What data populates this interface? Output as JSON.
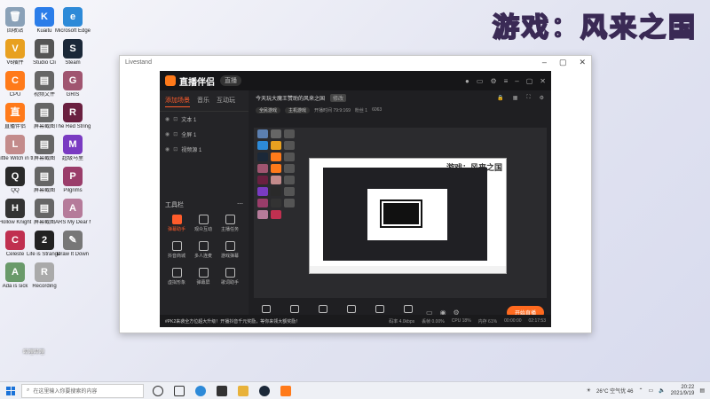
{
  "watermark": "游戏：风来之国",
  "desktop_icons": [
    {
      "label": "回收站",
      "color": "#8aa1b8",
      "glyph": "🗑"
    },
    {
      "label": "Kuaitu",
      "color": "#2b7de9",
      "glyph": "K"
    },
    {
      "label": "Microsoft Edge",
      "color": "#2d8ad8",
      "glyph": "e"
    },
    {
      "label": "V6插件",
      "color": "#e8a020",
      "glyph": "V"
    },
    {
      "label": "Studio Cli",
      "color": "#555",
      "glyph": "▤"
    },
    {
      "label": "Steam",
      "color": "#1b2838",
      "glyph": "S"
    },
    {
      "label": "CPU",
      "color": "#ff7a1a",
      "glyph": "C"
    },
    {
      "label": "视频文件",
      "color": "#666",
      "glyph": "▤"
    },
    {
      "label": "GRIS",
      "color": "#a05570",
      "glyph": "G"
    },
    {
      "label": "直播伴侣",
      "color": "#ff7a1a",
      "glyph": "直"
    },
    {
      "label": "屏幕截图",
      "color": "#666",
      "glyph": "▤"
    },
    {
      "label": "The Red Strings Club",
      "color": "#6a2040",
      "glyph": "R"
    },
    {
      "label": "Little Witch in the Woods",
      "color": "#c38b8b",
      "glyph": "L"
    },
    {
      "label": "屏幕截图",
      "color": "#666",
      "glyph": "▤"
    },
    {
      "label": "超级马里",
      "color": "#7a3bc2",
      "glyph": "M"
    },
    {
      "label": "QQ",
      "color": "#2a2a2a",
      "glyph": "Q"
    },
    {
      "label": "屏幕截图",
      "color": "#666",
      "glyph": "▤"
    },
    {
      "label": "Pilgrims",
      "color": "#9a3d6a",
      "glyph": "P"
    },
    {
      "label": "Hollow Knight",
      "color": "#333",
      "glyph": "H"
    },
    {
      "label": "屏幕截图",
      "color": "#666",
      "glyph": "▤"
    },
    {
      "label": "ARS My Dear M...",
      "color": "#b57b9a",
      "glyph": "A"
    },
    {
      "label": "Celeste",
      "color": "#c03050",
      "glyph": "C"
    },
    {
      "label": "Life is Strange 2",
      "color": "#222",
      "glyph": "2"
    },
    {
      "label": "Draw It Down",
      "color": "#777",
      "glyph": "✎"
    },
    {
      "label": "Ada is sick",
      "color": "#6a9a6a",
      "glyph": "A"
    },
    {
      "label": "Recording",
      "color": "#aaa",
      "glyph": "R"
    }
  ],
  "outer_window": {
    "title": "Livestand"
  },
  "app": {
    "name": "直播伴侣",
    "version_pill": "直播",
    "tabs": [
      "添加场景",
      "音乐",
      "互动玩"
    ],
    "active_tab": "添加场景",
    "sources": [
      "文本 1",
      "全屏 1",
      "视频源 1"
    ],
    "tools_title": "工具栏",
    "tools": [
      {
        "label": "弹幕助手",
        "hot": true
      },
      {
        "label": "观众互动",
        "hot": false
      },
      {
        "label": "主播任务",
        "hot": false
      },
      {
        "label": "抖音商城",
        "hot": false
      },
      {
        "label": "多人连麦",
        "hot": false
      },
      {
        "label": "游戏弹幕",
        "hot": false
      },
      {
        "label": "虚拟形象",
        "hot": false
      },
      {
        "label": "弹幕屏",
        "hot": false
      },
      {
        "label": "歌词助手",
        "hot": false
      }
    ],
    "stream_title": "今天玩大魔王赞助的风来之国",
    "stream_badge": "修改",
    "tags": [
      "全民游戏",
      "主机游戏"
    ],
    "meta": [
      "开播时间 79:9:169",
      "粉丝 1",
      "6063"
    ],
    "bottom_tools": [
      "直播屏幕",
      "摄像头",
      "手机投屏",
      "多媒体",
      "麦克风",
      "扬声器"
    ],
    "go_live": "开始直播",
    "announcement": "#PK2来袭全方位超大升级！开播抖音千元奖励，等你来领大额奖励！",
    "status_items": [
      "码率 4.0kbps",
      "丢帧 0.00%",
      "CPU 18%",
      "内存 61%"
    ],
    "timer": "00:00:00",
    "clock_small": "02:17:53"
  },
  "taskbar": {
    "search_placeholder": "在这里输入你要搜索的内容",
    "weather": "26°C 空气优 46",
    "time": "20:22",
    "date": "2021/9/19"
  },
  "bilibili": "哔哩哔哩"
}
